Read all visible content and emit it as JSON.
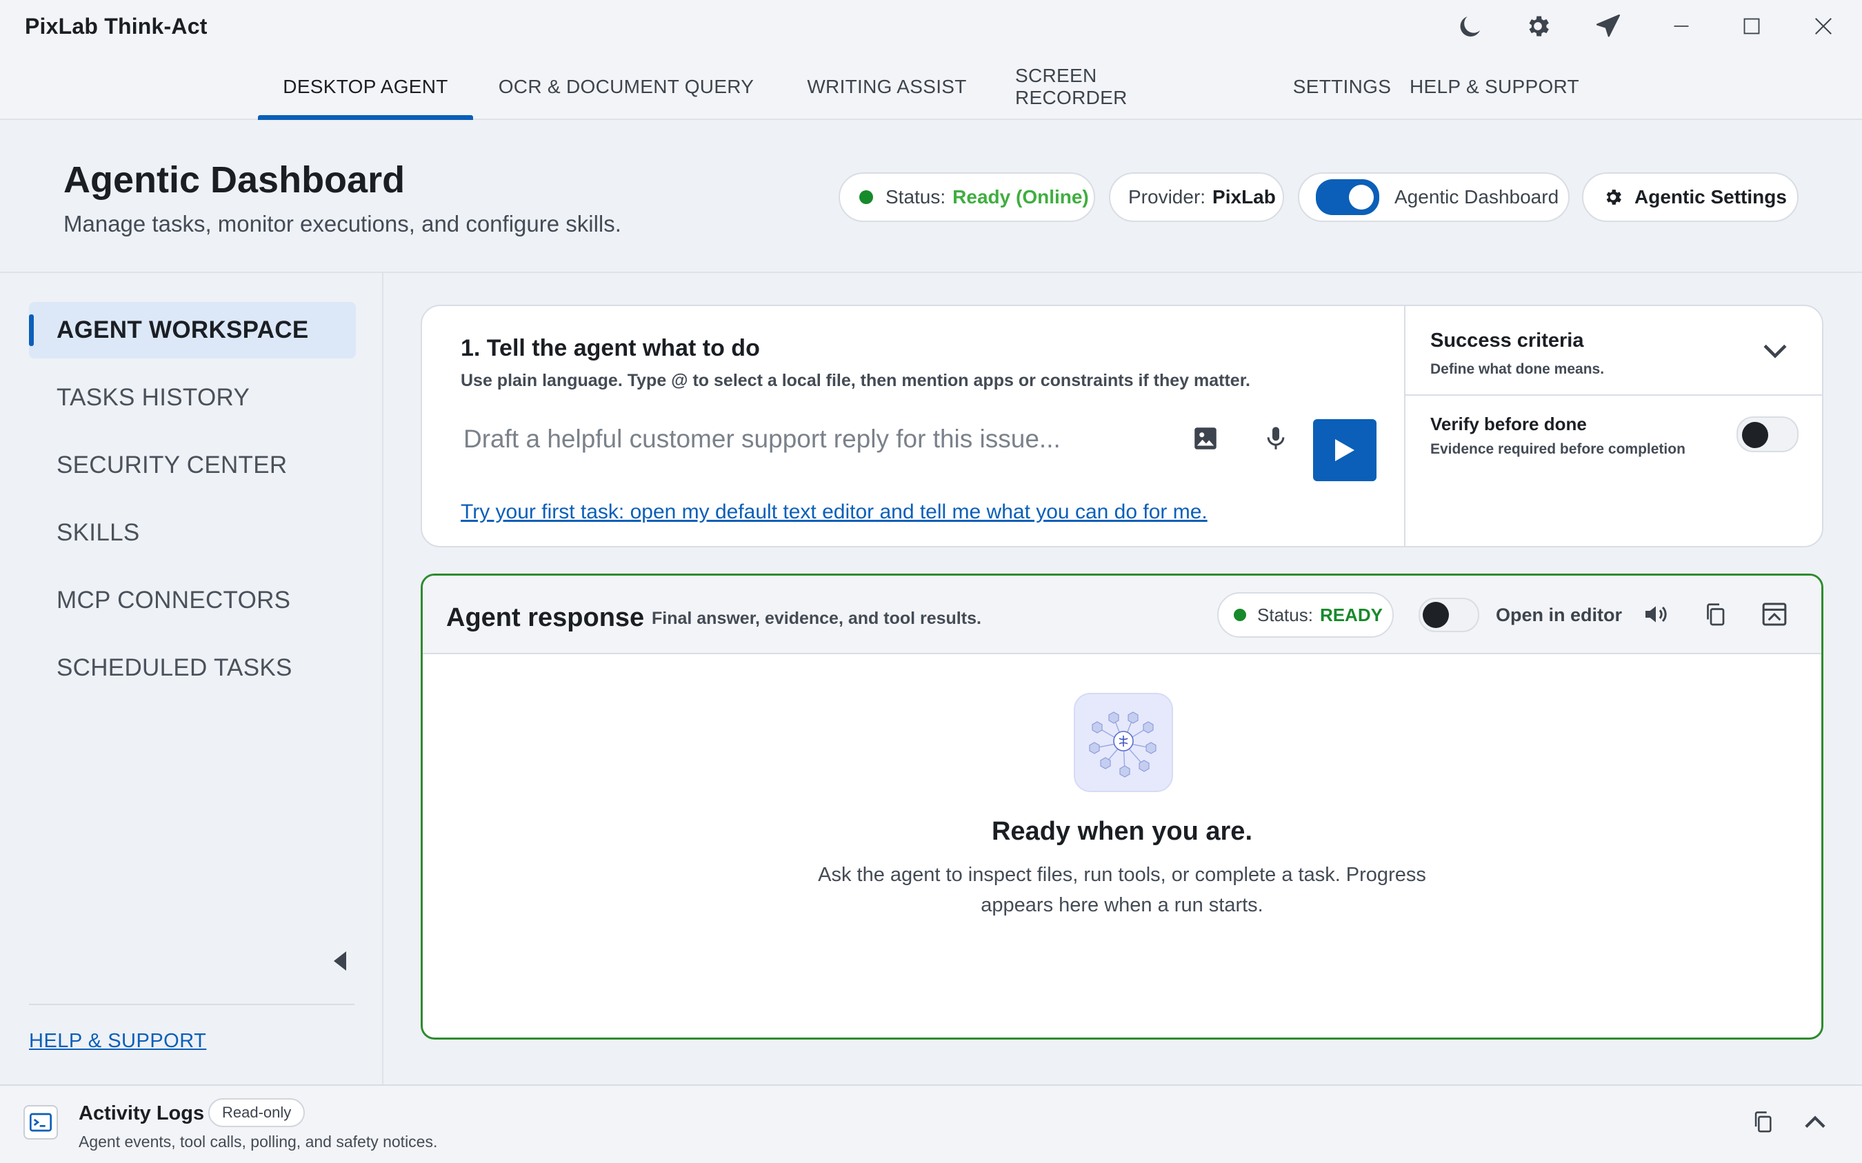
{
  "window": {
    "title": "PixLab Think-Act",
    "controls": [
      "moon-icon",
      "gear-icon",
      "paper-plane-icon",
      "minimize-icon",
      "maximize-icon",
      "close-icon"
    ]
  },
  "tabs": [
    {
      "label": "DESKTOP AGENT",
      "active": true
    },
    {
      "label": "OCR & DOCUMENT QUERY",
      "active": false
    },
    {
      "label": "WRITING ASSIST",
      "active": false
    },
    {
      "label": "SCREEN RECORDER",
      "active": false
    },
    {
      "label": "SETTINGS",
      "active": false
    },
    {
      "label": "HELP & SUPPORT",
      "active": false
    }
  ],
  "header": {
    "title": "Agentic Dashboard",
    "subtitle": "Manage tasks, monitor executions, and configure skills.",
    "status_label": "Status:",
    "status_value": "Ready (Online)",
    "provider_label": "Provider:",
    "provider_value": "PixLab",
    "toggle_label": "Agentic Dashboard",
    "toggle_on": true,
    "settings_button": "Agentic Settings"
  },
  "sidebar": {
    "items": [
      {
        "label": "AGENT WORKSPACE",
        "active": true
      },
      {
        "label": "TASKS HISTORY",
        "active": false
      },
      {
        "label": "SECURITY CENTER",
        "active": false
      },
      {
        "label": "SKILLS",
        "active": false
      },
      {
        "label": "MCP CONNECTORS",
        "active": false
      },
      {
        "label": "SCHEDULED TASKS",
        "active": false
      }
    ],
    "help_link": "HELP & SUPPORT"
  },
  "task": {
    "heading": "1. Tell the agent what to do",
    "hint": "Use plain language. Type @ to select a local file, then mention apps or constraints if they matter.",
    "input_value": "",
    "input_placeholder": "Draft a helpful customer support reply for this issue...",
    "first_task_link": "Try your first task: open my default text editor and tell me what you can do for me."
  },
  "criteria": {
    "title": "Success criteria",
    "subtitle": "Define what done means.",
    "verify_title": "Verify before done",
    "verify_subtitle": "Evidence required before completion",
    "verify_on": false
  },
  "response": {
    "title": "Agent response",
    "description": "Final answer, evidence, and tool results.",
    "status_label": "Status:",
    "status_value": "READY",
    "editor_toggle_label": "Open in editor",
    "editor_toggle_on": false,
    "empty_title": "Ready when you are.",
    "empty_text": "Ask the agent to inspect files, run tools, or complete a task. Progress appears here when a run starts."
  },
  "logs": {
    "title": "Activity Logs",
    "badge": "Read-only",
    "description": "Agent events, tool calls, polling, and safety notices."
  },
  "colors": {
    "accent": "#0b5fb8",
    "status_green": "#178a2b",
    "ready_green": "#2e8b2e",
    "link": "#0b5fb8"
  }
}
